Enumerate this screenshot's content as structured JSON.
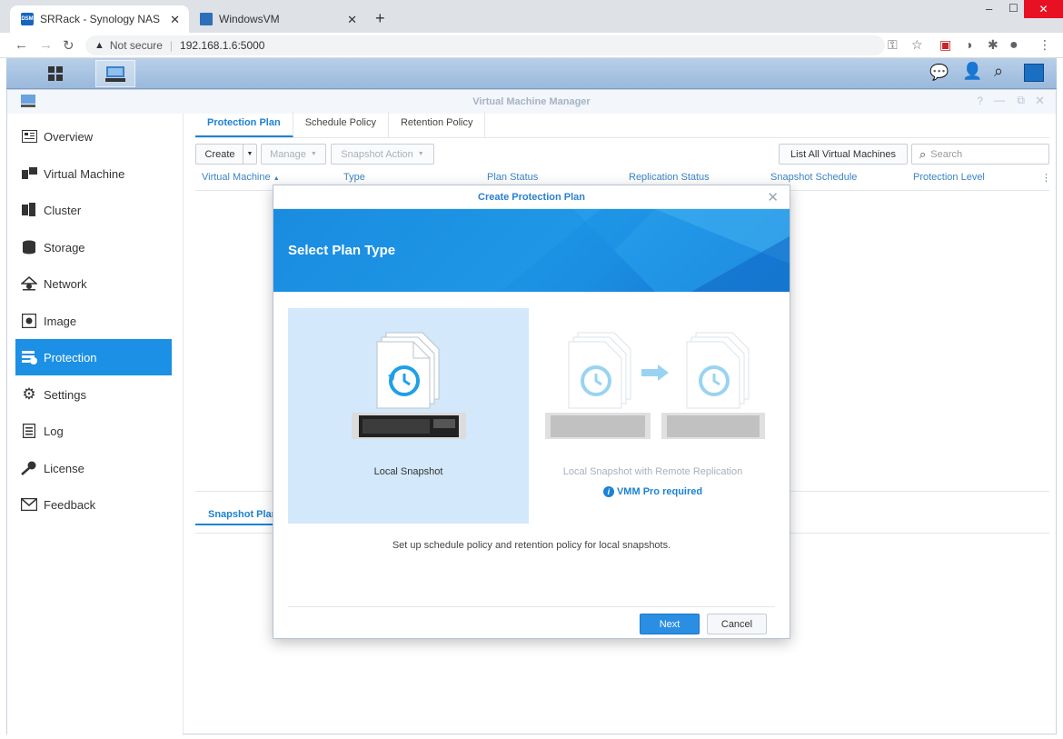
{
  "browser": {
    "tabs": [
      {
        "title": "SRRack - Synology NAS",
        "favicon": "dsm-favicon",
        "active": true
      },
      {
        "title": "WindowsVM",
        "favicon": "vm-favicon",
        "active": false
      }
    ],
    "new_tab": "+",
    "security": "Not secure",
    "url": "192.168.1.6:5000",
    "window_controls": [
      "–",
      "☐",
      "✕"
    ]
  },
  "app": {
    "title": "Virtual Machine Manager",
    "sidebar": [
      {
        "label": "Overview",
        "icon": "overview-icon"
      },
      {
        "label": "Virtual Machine",
        "icon": "virtual-machine-icon"
      },
      {
        "label": "Cluster",
        "icon": "cluster-icon"
      },
      {
        "label": "Storage",
        "icon": "storage-icon"
      },
      {
        "label": "Network",
        "icon": "network-icon"
      },
      {
        "label": "Image",
        "icon": "image-icon"
      },
      {
        "label": "Protection",
        "icon": "protection-icon",
        "active": true
      },
      {
        "label": "Settings",
        "icon": "settings-icon"
      },
      {
        "label": "Log",
        "icon": "log-icon"
      },
      {
        "label": "License",
        "icon": "license-icon"
      },
      {
        "label": "Feedback",
        "icon": "feedback-icon"
      }
    ],
    "top_tabs": [
      "Protection Plan",
      "Schedule Policy",
      "Retention Policy"
    ],
    "toolbar": {
      "create": "Create",
      "manage": "Manage",
      "snapshot_action": "Snapshot Action",
      "list_all": "List All Virtual Machines",
      "search_placeholder": "Search"
    },
    "columns": [
      "Virtual Machine",
      "Type",
      "Plan Status",
      "Replication Status",
      "Snapshot Schedule",
      "Protection Level"
    ],
    "bottom_tab": "Snapshot Plan"
  },
  "dialog": {
    "title": "Create Protection Plan",
    "banner_title": "Select Plan Type",
    "options": [
      {
        "label": "Local Snapshot",
        "selected": true
      },
      {
        "label": "Local Snapshot with Remote Replication",
        "selected": false,
        "note": "VMM Pro required"
      }
    ],
    "description": "Set up schedule policy and retention policy for local snapshots.",
    "next": "Next",
    "cancel": "Cancel"
  },
  "colors": {
    "accent": "#1c90e4",
    "banner": "#1a8ce0",
    "selected_option": "#d3e8fb"
  }
}
